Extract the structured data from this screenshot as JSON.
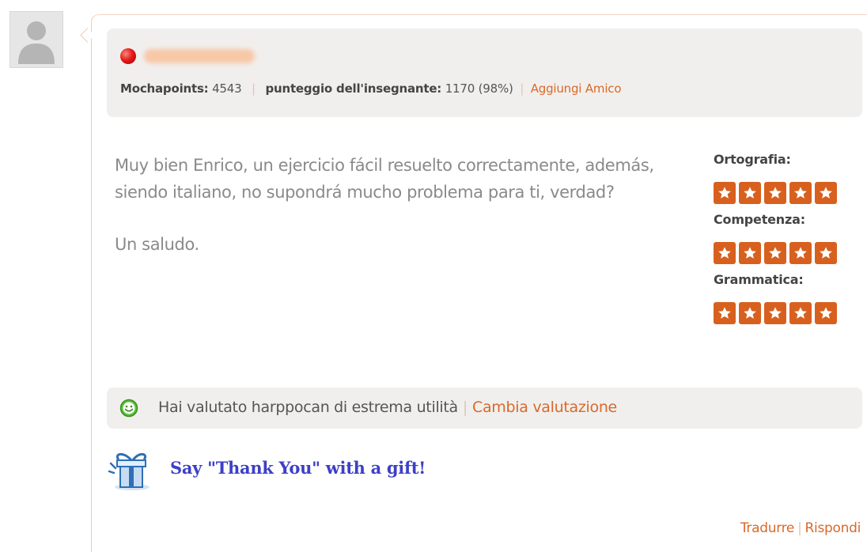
{
  "user": {
    "stats": {
      "mochapoints_label": "Mochapoints:",
      "mochapoints_value": "4543",
      "teacher_score_label": "punteggio dell'insegnante:",
      "teacher_score_value": "1170 (98%)",
      "add_friend": "Aggiungi Amico"
    },
    "status_color": "#e41b1b"
  },
  "comment": {
    "paragraphs": [
      "Muy bien Enrico, un ejercicio fácil resuelto correctamente, además, siendo italiano, no supondrá mucho problema para ti, verdad?",
      "Un saludo."
    ]
  },
  "ratings": [
    {
      "label": "Ortografia:",
      "stars": 5,
      "max": 5
    },
    {
      "label": "Competenza:",
      "stars": 5,
      "max": 5
    },
    {
      "label": "Grammatica:",
      "stars": 5,
      "max": 5
    }
  ],
  "usefulness": {
    "icon": "smiley-icon",
    "text": "Hai valutato harppocan di estrema utilità",
    "change_link": "Cambia valutazione"
  },
  "gift": {
    "icon": "gift-box-icon",
    "text": "Say \"Thank You\" with a gift!"
  },
  "footer": {
    "translate": "Tradurre",
    "reply": "Rispondi"
  },
  "colors": {
    "accent": "#d9692a",
    "star": "#d8601e",
    "gift_text": "#3d3fc6",
    "panel_bg": "#f1efed"
  }
}
